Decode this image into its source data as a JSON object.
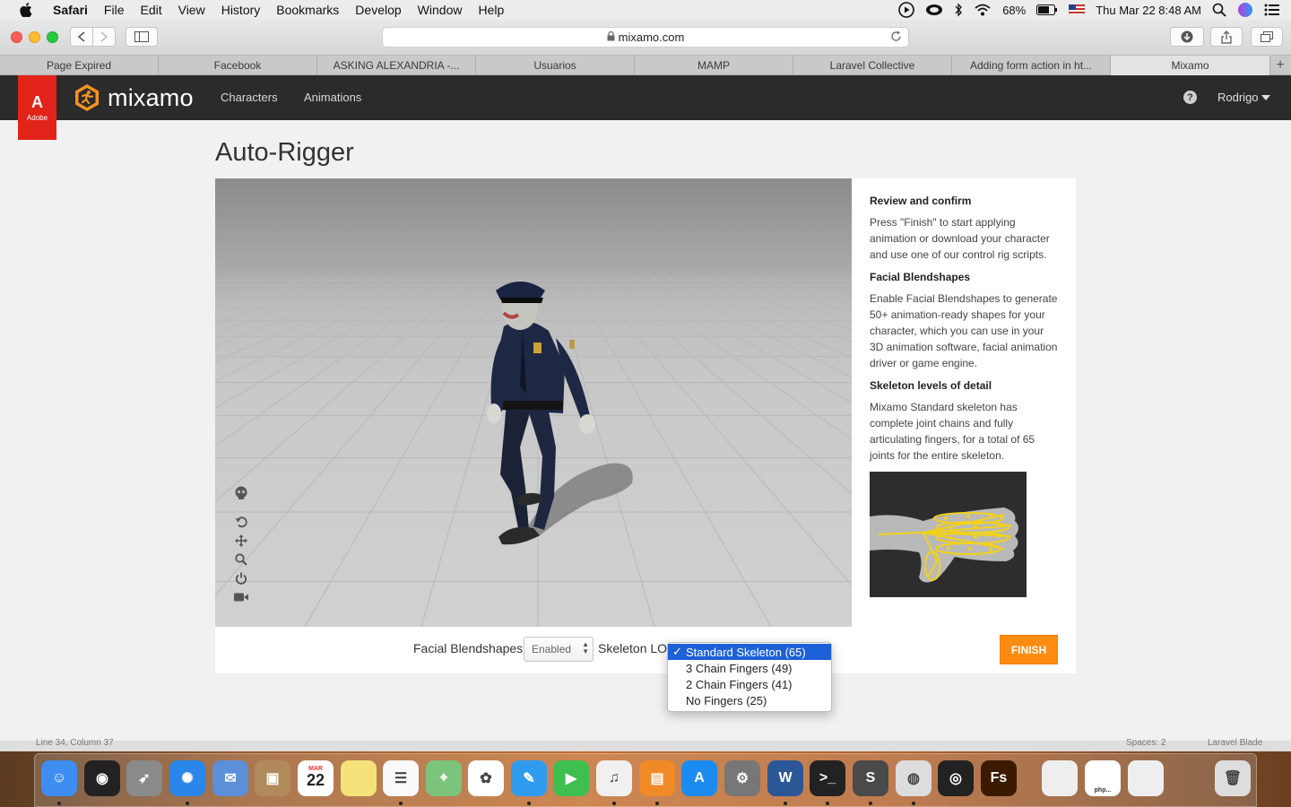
{
  "menubar": {
    "app_name": "Safari",
    "items": [
      "File",
      "Edit",
      "View",
      "History",
      "Bookmarks",
      "Develop",
      "Window",
      "Help"
    ],
    "battery": "68%",
    "datetime": "Thu Mar 22  8:48 AM"
  },
  "browser": {
    "url": "mixamo.com",
    "tabs": [
      "Page Expired",
      "Facebook",
      "ASKING ALEXANDRIA -...",
      "Usuarios",
      "MAMP",
      "Laravel Collective",
      "Adding form action in ht...",
      "Mixamo"
    ],
    "active_tab_index": 7
  },
  "site": {
    "adobe_letter": "A",
    "adobe_word": "Adobe",
    "logo_text": "mixamo",
    "nav": [
      "Characters",
      "Animations"
    ],
    "help": "?",
    "user": "Rodrigo",
    "accent_color": "#ff8c12"
  },
  "page": {
    "title": "Auto-Rigger"
  },
  "viewport": {
    "tools": [
      "skeleton-icon",
      "reset-view-icon",
      "pan-icon",
      "zoom-icon",
      "power-icon",
      "camera-icon"
    ]
  },
  "side_panel": {
    "sections": [
      {
        "heading": "Review and confirm",
        "text": "Press \"Finish\" to start applying animation or download your character and use one of our control rig scripts."
      },
      {
        "heading": "Facial Blendshapes",
        "text": "Enable Facial Blendshapes to generate 50+ animation-ready shapes for your character, which you can use in your 3D animation software, facial animation driver or game engine."
      },
      {
        "heading": "Skeleton levels of detail",
        "text": "Mixamo Standard skeleton has complete joint chains and fully articulating fingers, for a total of 65 joints for the entire skeleton."
      }
    ]
  },
  "options": {
    "facial_label": "Facial Blendshapes",
    "facial_value": "Enabled",
    "skeleton_label": "Skeleton LO",
    "finish_label": "FINISH"
  },
  "dropdown": {
    "check": "✓",
    "options": [
      "Standard Skeleton (65)",
      "3 Chain Fingers (49)",
      "2 Chain Fingers (41)",
      "No Fingers (25)"
    ],
    "selected_index": 0
  },
  "editor_strip": {
    "left": "Line 34, Column 37",
    "right_1": "Spaces: 2",
    "right_2": "Laravel Blade"
  },
  "dock": {
    "apps": [
      "Finder",
      "Siri",
      "Launchpad",
      "Safari",
      "Mail",
      "Contacts",
      "Calendar",
      "Notes",
      "Reminders",
      "Maps",
      "Photos",
      "Messages",
      "FaceTime",
      "iTunes",
      "iBooks",
      "App Store",
      "System Preferences",
      "Word",
      "Terminal",
      "Sublime Text",
      "TablePlus",
      "Flashback",
      "Fs",
      "Folder",
      "php",
      "Downloads",
      "Trash"
    ],
    "calendar_month": "MAR",
    "calendar_day": "22",
    "php_label": "php..."
  }
}
